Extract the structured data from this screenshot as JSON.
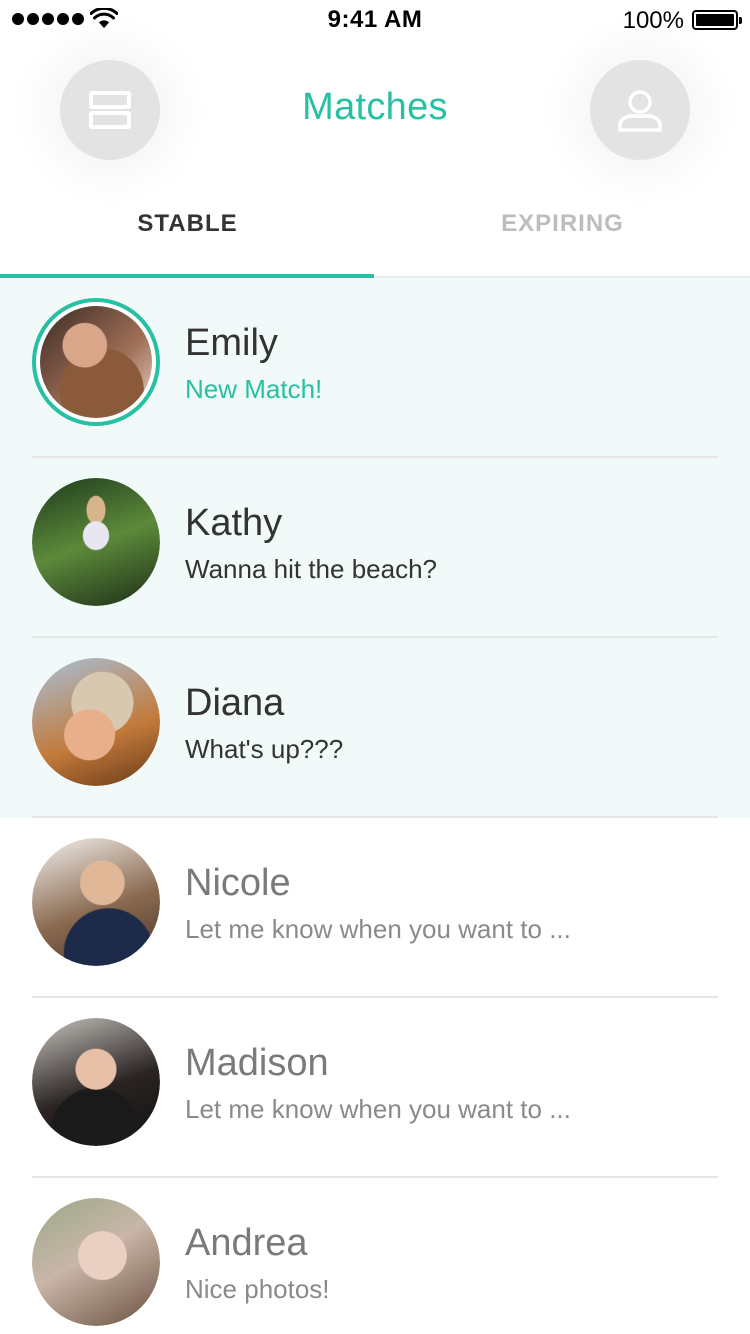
{
  "status_bar": {
    "time": "9:41 AM",
    "battery": "100%"
  },
  "header": {
    "title": "Matches",
    "left_icon": "stack-icon",
    "right_icon": "profile-icon"
  },
  "tabs": [
    {
      "label": "STABLE",
      "active": true
    },
    {
      "label": "EXPIRING",
      "active": false
    }
  ],
  "colors": {
    "accent": "#27c0a2",
    "highlight_bg": "#f1faf8"
  },
  "matches": [
    {
      "name": "Emily",
      "message": "New Match!"
    },
    {
      "name": "Kathy",
      "message": "Wanna hit the beach?"
    },
    {
      "name": "Diana",
      "message": "What's up???"
    },
    {
      "name": "Nicole",
      "message": "Let me know when you want to ..."
    },
    {
      "name": "Madison",
      "message": "Let me know when you want to ..."
    },
    {
      "name": "Andrea",
      "message": "Nice photos!"
    }
  ]
}
